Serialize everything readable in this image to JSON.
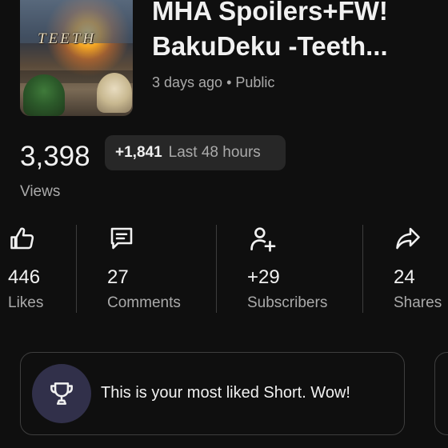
{
  "video": {
    "thumbnail_text": "TEETH",
    "title_line1": "MHA Spoilers+FW!",
    "title_line2": "BakuDeku -Teeth...",
    "meta": "3 days ago • Public"
  },
  "views": {
    "count": "3,398",
    "delta": "+1,841",
    "window": "Last 48 hours",
    "label": "Views"
  },
  "stats": [
    {
      "icon": "thumbs-up-icon",
      "value": "446",
      "label": "Likes"
    },
    {
      "icon": "comment-icon",
      "value": "27",
      "label": "Comments"
    },
    {
      "icon": "add-person-icon",
      "value": "+29",
      "label": "Subscribers"
    },
    {
      "icon": "share-icon",
      "value": "24",
      "label": "Shares"
    }
  ],
  "insight": {
    "icon": "trophy-icon",
    "message": "This is your most liked Short. Wow!"
  },
  "colors": {
    "background": "#0f0f0f",
    "pill": "#272727",
    "trophy_circle": "#31304a",
    "secondary_text": "#aaaaaa"
  }
}
